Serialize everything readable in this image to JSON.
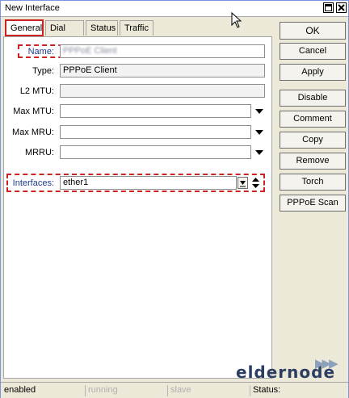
{
  "window": {
    "title": "New Interface"
  },
  "tabs": [
    {
      "label": "General",
      "active": true
    },
    {
      "label": "Dial Out",
      "active": false
    },
    {
      "label": "Status",
      "active": false
    },
    {
      "label": "Traffic",
      "active": false
    }
  ],
  "form": {
    "name": {
      "label": "Name:",
      "value": "PPPoE Client"
    },
    "type": {
      "label": "Type:",
      "value": "PPPoE Client"
    },
    "l2mtu": {
      "label": "L2 MTU:",
      "value": ""
    },
    "max_mtu": {
      "label": "Max MTU:",
      "value": ""
    },
    "max_mru": {
      "label": "Max MRU:",
      "value": ""
    },
    "mrru": {
      "label": "MRRU:",
      "value": ""
    },
    "interfaces": {
      "label": "Interfaces:",
      "value": "ether1"
    }
  },
  "buttons": {
    "ok": "OK",
    "cancel": "Cancel",
    "apply": "Apply",
    "disable": "Disable",
    "comment": "Comment",
    "copy": "Copy",
    "remove": "Remove",
    "torch": "Torch",
    "pppoe_scan": "PPPoE Scan"
  },
  "status_bar": {
    "enabled": "enabled",
    "running": "running",
    "slave": "slave",
    "status": "Status:"
  },
  "watermark": {
    "part1": "elder",
    "part2": "node"
  },
  "colors": {
    "highlight_border": "#cc2222",
    "label_blue": "#1f3a8a"
  }
}
